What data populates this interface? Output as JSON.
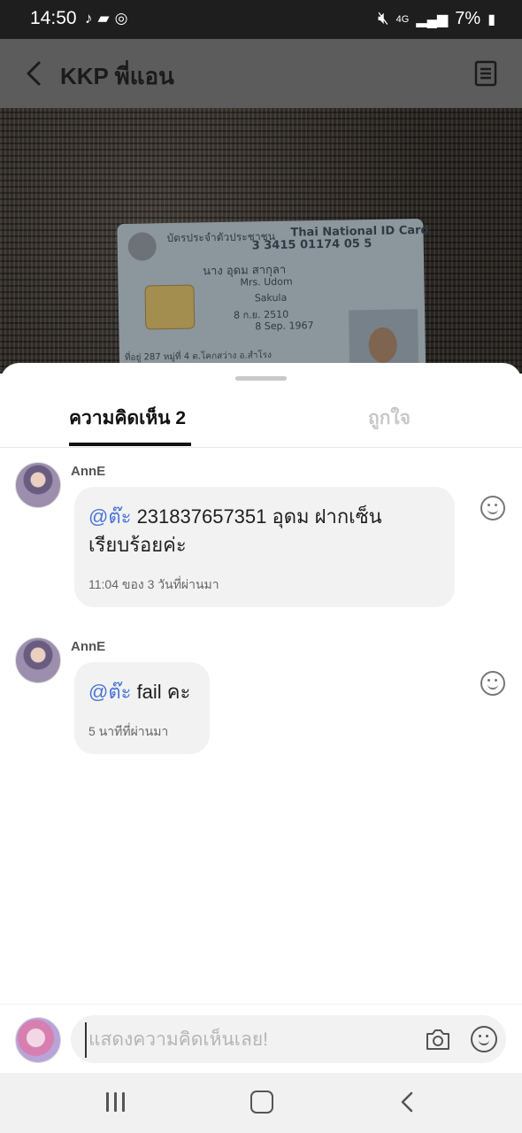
{
  "status_bar": {
    "time": "14:50",
    "left_icons": [
      "tiktok-icon",
      "message-icon",
      "sync-icon"
    ],
    "network": "4G",
    "battery": "7%"
  },
  "header": {
    "title": "KKP พี่แอน"
  },
  "id_card": {
    "title_th": "บัตรประจำตัวประชาชน",
    "title_en": "Thai National ID Card",
    "id_number": "3 3415 01174 05 5",
    "name_th": "นาง อุดม สากุลา",
    "name_en": "Mrs. Udom",
    "last_name_en": "Sakula",
    "dob_th": "8 ก.ย. 2510",
    "dob_en": "8 Sep. 1967",
    "address": "ที่อยู่ 287 หมู่ที่ 4 ต.โคกสว่าง อ.สำโรง"
  },
  "tabs": {
    "comments": "ความคิดเห็น 2",
    "likes": "ถูกใจ"
  },
  "comments": [
    {
      "username": "AnnE",
      "mention": "@ต๊ะ",
      "text": "231837657351 อุดม ฝากเซ็น",
      "text_line2": "เรียบร้อยค่ะ",
      "time": "11:04 ของ 3 วันที่ผ่านมา"
    },
    {
      "username": "AnnE",
      "mention": "@ต๊ะ",
      "text": "fail คะ",
      "time": "5 นาทีที่ผ่านมา"
    }
  ],
  "composer": {
    "placeholder": "แสดงความคิดเห็นเลย!"
  },
  "colors": {
    "mention": "#4a74d6",
    "bubble": "#f2f2f2",
    "tab_inactive": "#c8c8c8"
  }
}
